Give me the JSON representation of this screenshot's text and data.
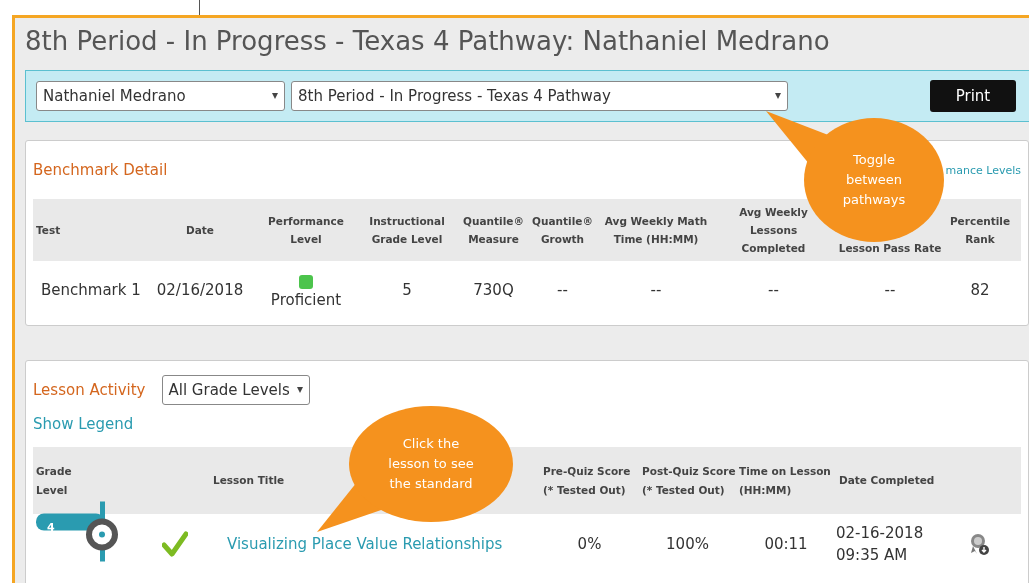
{
  "page_title": "8th Period - In Progress - Texas 4 Pathway: Nathaniel Medrano",
  "filters": {
    "student": "Nathaniel Medrano",
    "pathway": "8th Period - In Progress - Texas 4 Pathway",
    "print_button": "Print"
  },
  "benchmark": {
    "title": "Benchmark Detail",
    "link": "mance Levels",
    "columns": [
      "Test",
      "Date",
      "Performance Level",
      "Instructional Grade Level",
      "Quantile® Measure",
      "Quantile® Growth",
      "Avg Weekly Math Time (HH:MM)",
      "Avg Weekly Lessons Completed",
      "Lesson Pass Rate",
      "Percentile Rank"
    ],
    "rows": [
      {
        "test": "Benchmark 1",
        "date": "02/16/2018",
        "performance": "Proficient",
        "color": "#4cc44c",
        "grade": "5",
        "measure": "730Q",
        "growth": "--",
        "math_time": "--",
        "lessons": "--",
        "pass_rate": "--",
        "percentile": "82"
      }
    ]
  },
  "lesson_activity": {
    "title": "Lesson Activity",
    "grade_filter": "All Grade Levels",
    "legend_link": "Show Legend",
    "columns": [
      "Grade Level",
      "Lesson Title",
      "Pre-Quiz Score (* Tested Out)",
      "Post-Quiz Score (* Tested Out)",
      "Time on Lesson (HH:MM)",
      "Date Completed"
    ],
    "rows": [
      {
        "grade": "4",
        "completed": true,
        "title": "Visualizing Place Value Relationships",
        "pre": "0%",
        "post": "100%",
        "time": "00:11",
        "date": "02-16-2018",
        "clock": "09:35 AM"
      }
    ]
  },
  "callouts": [
    "Toggle between pathways",
    "Click the lesson to see the standard"
  ]
}
